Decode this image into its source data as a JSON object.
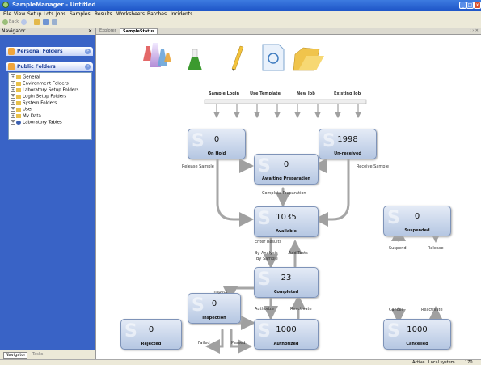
{
  "window": {
    "title": "SampleManager - Untitled"
  },
  "menu": [
    "File",
    "View",
    "Setup",
    "Lots",
    "Jobs",
    "Samples",
    "Results",
    "Worksheets",
    "Batches",
    "Incidents"
  ],
  "toolbar": {
    "back_label": "Back"
  },
  "navigator": {
    "title": "Navigator",
    "close_label": "✕",
    "groups": [
      {
        "label": "Personal Folders"
      },
      {
        "label": "Public Folders"
      }
    ],
    "tree": [
      "General",
      "Environment Folders",
      "Laboratory Setup Folders",
      "Login Setup Folders",
      "System Folders",
      "User",
      "My Data",
      "Laboratory Tables"
    ],
    "bottom_tabs": [
      "Navigator",
      "Tasks"
    ]
  },
  "tabs": [
    {
      "label": "Explorer"
    },
    {
      "label": "SampleStatus"
    }
  ],
  "tools": [
    {
      "label": "Sample Login",
      "icon": "lab-flasks-icon"
    },
    {
      "label": "Use Template",
      "icon": "flask-icon"
    },
    {
      "label": "New Job",
      "icon": "pencil-icon"
    },
    {
      "label": "Existing Job",
      "icon": "document-icon"
    }
  ],
  "statuses": {
    "on_hold": {
      "label": "On Hold",
      "count": "0"
    },
    "unreceived": {
      "label": "Un-received",
      "count": "1998"
    },
    "awaiting": {
      "label": "Awaiting Preparation",
      "count": "0"
    },
    "available": {
      "label": "Available",
      "count": "1035"
    },
    "suspended": {
      "label": "Suspended",
      "count": "0"
    },
    "completed": {
      "label": "Completed",
      "count": "23"
    },
    "inspection": {
      "label": "Inspection",
      "count": "0"
    },
    "rejected": {
      "label": "Rejected",
      "count": "0"
    },
    "authorized": {
      "label": "Authorized",
      "count": "1000"
    },
    "cancelled": {
      "label": "Cancelled",
      "count": "1000"
    }
  },
  "flow_labels": {
    "release_sample": "Release Sample",
    "receive_sample": "Receive Sample",
    "complete_preparation": "Complete Preparation",
    "enter_results": "Enter Results",
    "by_analysis": "By Analysis",
    "by_sample": "By Sample",
    "add_tests": "Add Tests",
    "suspend": "Suspend",
    "release": "Release",
    "inspect": "Inspect",
    "authorize": "Authorize",
    "reactivate": "Reactivate",
    "failed": "Failed",
    "passed": "Passed",
    "cancel": "Cancel",
    "reactivate2": "Reactivate"
  },
  "statusbar": {
    "state": "Active",
    "system": "Local system",
    "number": "170"
  },
  "colors": {
    "titlebar": "#245edb",
    "navigator": "#3963c6",
    "box": "#c9d6ec",
    "connector": "#a0a0a0"
  }
}
